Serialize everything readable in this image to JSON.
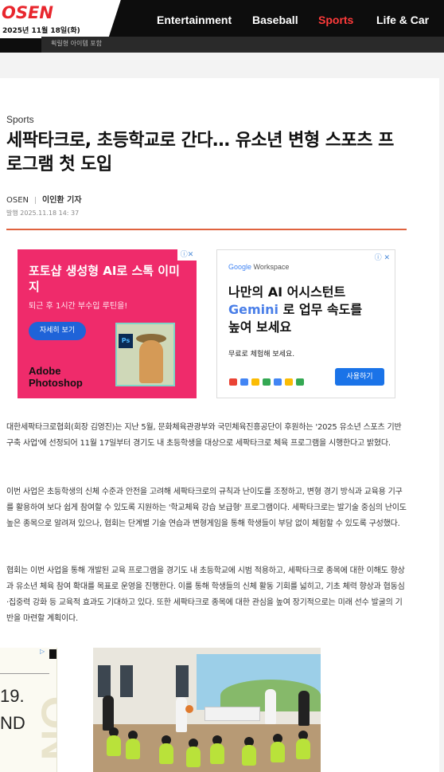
{
  "header": {
    "logo": "OSEN",
    "date": "2025년 11월 18일(화)",
    "strip_text": "획릴형 아이템 포함",
    "nav": [
      {
        "label": "Entertainment"
      },
      {
        "label": "Baseball"
      },
      {
        "label": "Sports",
        "active": true
      },
      {
        "label": "Life & Car"
      }
    ]
  },
  "article": {
    "section": "Sports",
    "title": "세팍타크로, 초등학교로 간다… 유소년 변형 스포츠 프로그램 첫 도입",
    "source": "OSEN",
    "reporter": "이인환 기자",
    "published": "발행 2025.11.18 14: 37",
    "paragraphs": [
      "  대한세팍타크로협회(회장 김영진)는 지난 5월, 문화체육관광부와 국민체육진흥공단이 후원하는 '2025 유소년 스포츠 기반 구축 사업'에 선정되어 11월 17일부터 경기도 내 초등학생을 대상으로 세팍타크로 체육 프로그램을 시행한다고 밝혔다.",
      "이번 사업은 초등학생의 신체 수준과 안전을 고려해 세팍타크로의 규칙과 난이도를 조정하고, 변형 경기 방식과 교육용 기구를 활용하여 보다 쉽게 참여할 수 있도록 지원하는 '학교체육 강습 보급형' 프로그램이다. 세팍타크로는 발기술 중심의 난이도 높은 종목으로 알려져 있으나, 협회는 단계별 기술 연습과 변형게임을 통해 학생들이 부담 없이 체험할 수 있도록 구성했다.",
      "협회는 이번 사업을 통해 개발된 교육 프로그램을 경기도 내 초등학교에 시범 적용하고, 세팍타크로 종목에 대한 이해도 향상과 유소년 체육 참여 확대를 목표로 운영을 진행한다. 이를 통해 학생들의 신체 활동 기회를 넓히고, 기초 체력 향상과 협동심·집중력 강화 등 교육적 효과도 기대하고 있다. 또한 세팍타크로 종목에 대한 관심을 높여 장기적으로는 미래 선수 발굴의 기반을 마련할 계획이다."
    ]
  },
  "ads": {
    "adobe": {
      "close": "ⓘ✕",
      "title": "포토샵 생성형 AI로 스톡 이미지",
      "subtitle": "퇴근 후 1시간 부수입 루틴을!",
      "button": "자세히 보기",
      "brand_line1": "Adobe",
      "brand_line2": "Photoshop",
      "ps_icon": "Ps"
    },
    "google": {
      "brand_google": "Google",
      "brand_workspace": " Workspace",
      "info": "ⓘ ✕",
      "title_line1": "나만의 AI 어시스턴트",
      "title_gemini": "Gemini",
      "title_line2_rest": " 로 업무 속도를",
      "title_line3": "높여 보세요",
      "subtitle": "무료로 체험해 보세요.",
      "button": "사용하기",
      "icon_colors": [
        "#ea4335",
        "#4285f4",
        "#fbbc04",
        "#34a853",
        "#4285f4",
        "#fbbc04",
        "#34a853"
      ]
    },
    "side": {
      "tag": "▷",
      "num": "19.",
      "txt": "ND",
      "big": "ON"
    }
  },
  "colors": {
    "accent_red": "#e8262d",
    "active_nav": "#ff3b3b",
    "rule": "#e0623e"
  }
}
